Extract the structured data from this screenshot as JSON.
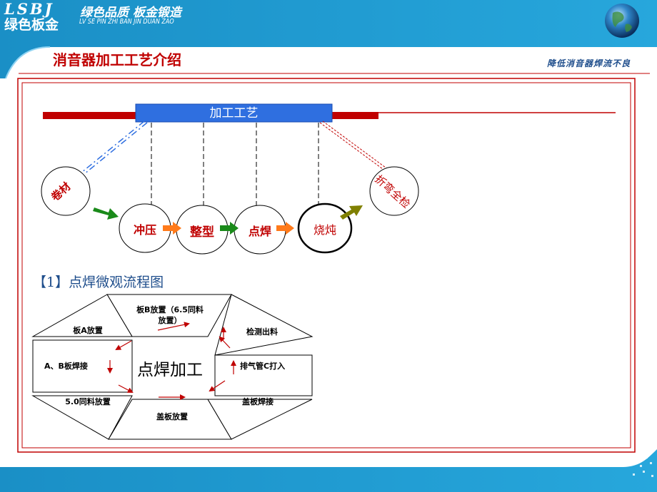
{
  "brand": {
    "name_en": "LSBJ",
    "slogan": "绿色品质 板金锻造",
    "name_cn": "绿色板金",
    "pinyin": "LV SE PIN ZHI BAN JIN DUAN ZAO"
  },
  "page_title": "消音器加工工艺介绍",
  "subtitle": "降低消音器焊流不良",
  "process": {
    "hub_label": "加工工艺",
    "start_node": "卷材",
    "end_node": "折弯全检",
    "steps": [
      "冲压",
      "整型",
      "点焊",
      "烧炖"
    ]
  },
  "section": {
    "heading": "【1】点焊微观流程图",
    "center_label": "点焊加工",
    "segments": {
      "top": "板B放置（6.5同料放置）",
      "upper_left": "板A放置",
      "left": "A、B板焊接",
      "lower_left": "5.0同料放置",
      "bottom": "盖板放置",
      "lower_right": "盖板焊接",
      "right": "排气管C打入",
      "upper_right": "检测出料"
    }
  },
  "colors": {
    "banner": "#1d96cc",
    "accent_red": "#c00000",
    "hub_blue": "#2f6fe0",
    "heading_blue": "#1f4e8c",
    "arrow_green": "#1a8a1a",
    "arrow_orange": "#ff7a1a",
    "arrow_olive": "#808000"
  },
  "icons": [
    "globe-icon"
  ]
}
